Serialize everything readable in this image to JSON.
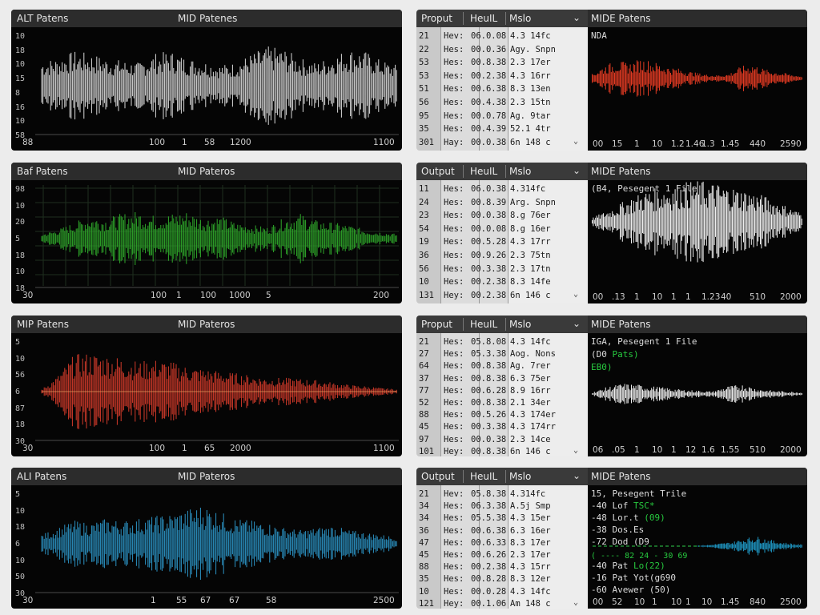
{
  "colors": {
    "white": "#d9d9d9",
    "green": "#2ea82a",
    "red": "#d23a2a",
    "blue": "#2b92c4",
    "log_white": "#eeeeee",
    "log_red": "#e03a22",
    "log_blue": "#1f9ac8",
    "log_green": "#2ed04b"
  },
  "wave_panels": [
    {
      "title_left": "ALT Patens",
      "title_right": "MID Patenes",
      "y_labels": [
        "10",
        "18",
        "10",
        "15",
        "8",
        "16",
        "10",
        "58"
      ],
      "x_labels": [
        "88",
        "100",
        "1",
        "58",
        "1200",
        "1100"
      ],
      "grid": false,
      "color": "white",
      "envelope": [
        0.55,
        0.6,
        0.75,
        0.7,
        0.6,
        0.55,
        0.5,
        0.7,
        0.75,
        0.6,
        0.55,
        0.45,
        0.5,
        0.7,
        0.85,
        0.8,
        0.6,
        0.5,
        0.65,
        0.8,
        0.75,
        0.55,
        0.45
      ]
    },
    {
      "title_left": "Baf Patens",
      "title_right": "MID Pateros",
      "y_labels": [
        "98",
        "10",
        "20",
        "5",
        "18",
        "10",
        "18"
      ],
      "x_labels": [
        "30",
        "100",
        "1",
        "100",
        "1000",
        "5",
        "200"
      ],
      "grid": true,
      "color": "green",
      "envelope": [
        0.1,
        0.2,
        0.35,
        0.5,
        0.45,
        0.55,
        0.6,
        0.5,
        0.55,
        0.6,
        0.45,
        0.5,
        0.35,
        0.3,
        0.25,
        0.45,
        0.55,
        0.4,
        0.35,
        0.3,
        0.2,
        0.15,
        0.1
      ]
    },
    {
      "title_left": "MIP Patens",
      "title_right": "MID Pateros",
      "y_labels": [
        "5",
        "10",
        "56",
        "6",
        "87",
        "18",
        "30"
      ],
      "x_labels": [
        "30",
        "100",
        "1",
        "65",
        "2000",
        "1100"
      ],
      "grid": false,
      "color": "red",
      "envelope": [
        0.05,
        0.35,
        0.8,
        0.85,
        0.8,
        0.75,
        0.65,
        0.7,
        0.65,
        0.55,
        0.5,
        0.45,
        0.4,
        0.35,
        0.3,
        0.3,
        0.28,
        0.25,
        0.2,
        0.15,
        0.12,
        0.08,
        0.05
      ]
    },
    {
      "title_left": "ALI Patens",
      "title_right": "MID Pateros",
      "y_labels": [
        "5",
        "10",
        "18",
        "6",
        "10",
        "50",
        "30"
      ],
      "x_labels": [
        "30",
        "1",
        "55",
        "67",
        "67",
        "58",
        "2500"
      ],
      "grid": false,
      "color": "blue",
      "envelope": [
        0.2,
        0.35,
        0.5,
        0.45,
        0.55,
        0.5,
        0.55,
        0.6,
        0.65,
        0.75,
        0.85,
        0.7,
        0.55,
        0.5,
        0.45,
        0.35,
        0.3,
        0.35,
        0.4,
        0.3,
        0.25,
        0.2,
        0.15
      ]
    }
  ],
  "tables": [
    {
      "headers": [
        "Proput",
        "HeuIL",
        "Mslo"
      ],
      "rows": [
        [
          "21",
          "Hev:",
          "06.0.08",
          "4.3 14fc"
        ],
        [
          "22",
          "Hes:",
          "00.0.36",
          "Agy. Snpn"
        ],
        [
          "53",
          "Hes:",
          "00.8.38",
          "2.3 17er"
        ],
        [
          "53",
          "Hes:",
          "00.2.38",
          "4.3 16rr"
        ],
        [
          "51",
          "Hes:",
          "00.6.38",
          "8.3 13en"
        ],
        [
          "56",
          "Hes:",
          "00.4.38",
          "2.3 15tn"
        ],
        [
          "95",
          "Hes:",
          "00.0.78",
          "Ag. 9tar"
        ],
        [
          "35",
          "Hes:",
          "00.4.39",
          "52.1 4tr"
        ],
        [
          "301",
          "Hay:",
          "00.0.38",
          "6n 148 c"
        ]
      ]
    },
    {
      "headers": [
        "Output",
        "HeuIL",
        "Mslo"
      ],
      "rows": [
        [
          "11",
          "Hes:",
          "06.0.38",
          "4.314fc"
        ],
        [
          "24",
          "Hes:",
          "00.8.39",
          "Arg. Snpn"
        ],
        [
          "23",
          "Hes:",
          "00.0.38",
          "8.g 76er"
        ],
        [
          "54",
          "Hes:",
          "00.0.08",
          "8.g 16er"
        ],
        [
          "19",
          "Hes:",
          "00.5.28",
          "4.3 17rr"
        ],
        [
          "36",
          "Hes:",
          "00.9.26",
          "2.3 75tn"
        ],
        [
          "56",
          "Hes:",
          "00.3.38",
          "2.3 17tn"
        ],
        [
          "10",
          "Hes:",
          "00.2.38",
          "8.3 14fe"
        ],
        [
          "131",
          "Hey:",
          "00.2.38",
          "6n 146 c"
        ]
      ]
    },
    {
      "headers": [
        "Proput",
        "HeuIL",
        "Mslo"
      ],
      "rows": [
        [
          "21",
          "Hes:",
          "05.8.08",
          "4.3 14fc"
        ],
        [
          "27",
          "Hes:",
          "05.3.38",
          "Aog. Nons"
        ],
        [
          "64",
          "Hes:",
          "00.8.38",
          "Ag. 7rer"
        ],
        [
          "37",
          "Hes:",
          "00.8.38",
          "6.3 75er"
        ],
        [
          "77",
          "Hes:",
          "00.6.28",
          "8.9 16rr"
        ],
        [
          "52",
          "Hes:",
          "00.8.38",
          "2.1 34er"
        ],
        [
          "88",
          "Hes:",
          "00.5.26",
          "4.3 174er"
        ],
        [
          "45",
          "Hes:",
          "00.3.38",
          "4.3 174rr"
        ],
        [
          "97",
          "Hes:",
          "00.0.38",
          "2.3 14ce"
        ],
        [
          "101",
          "Hey:",
          "00.8.38",
          "6n 146 c"
        ]
      ]
    },
    {
      "headers": [
        "Output",
        "HeuIL",
        "Mslo"
      ],
      "rows": [
        [
          "21",
          "Hev:",
          "05.8.38",
          "4.314fc"
        ],
        [
          "34",
          "Hes:",
          "06.3.38",
          "A.5j Smp"
        ],
        [
          "34",
          "Hes:",
          "05.5.38",
          "4.3 15er"
        ],
        [
          "36",
          "Hes:",
          "00.6.38",
          "6.3 16er"
        ],
        [
          "47",
          "Hes:",
          "00.6.33",
          "8.3 17er"
        ],
        [
          "45",
          "Hes:",
          "00.6.26",
          "2.3 17er"
        ],
        [
          "88",
          "Hes:",
          "00.2.38",
          "4.3 15rr"
        ],
        [
          "35",
          "Hes:",
          "00.8.28",
          "8.3 12er"
        ],
        [
          "10",
          "Hes:",
          "00.0.28",
          "4.3 14fc"
        ],
        [
          "121",
          "Hey:",
          "00.1.06",
          "Am 148 c"
        ]
      ]
    }
  ],
  "log_panels": [
    {
      "title": "MIDE Patens",
      "lines": [
        {
          "text": "NDA",
          "green": ""
        }
      ],
      "x_labels": [
        "00",
        "15",
        "1",
        "10",
        "1.2",
        "1.46",
        "1.3",
        "1.45",
        "440",
        "2590"
      ]
    },
    {
      "title": "MIDE Patens",
      "lines": [
        {
          "text": "(B4, Pesegent 1 File",
          "green": ""
        }
      ],
      "x_labels": [
        "00",
        ".13",
        "1",
        "10",
        "1",
        "1",
        "1.23",
        "40",
        "510",
        "2000"
      ]
    },
    {
      "title": "MIDE Patens",
      "lines": [
        {
          "text": "IGA, Pesegent 1 File",
          "green": ""
        },
        {
          "text": "(D0 ",
          "green": "Pats)"
        },
        {
          "text": "",
          "green": "EB0)"
        }
      ],
      "x_labels": [
        "06",
        ".05",
        "1",
        "10",
        "1",
        "12",
        "1.6",
        "1.55",
        "510",
        "2000"
      ]
    },
    {
      "title": "MIDE Patens",
      "lines": [
        {
          "text": "15, Pesegent Trile",
          "green": ""
        },
        {
          "text": "-40 Lof ",
          "green": "TSC*"
        },
        {
          "text": "-48 Lor.t ",
          "green": "(09)"
        },
        {
          "text": "-38 Dos.Es",
          "green": ""
        },
        {
          "text": "-72 Dod (D9",
          "green": ""
        },
        {
          "text": "",
          "green": "( ---- 82 24 - 30 69"
        },
        {
          "text": "-40 Pat ",
          "green": "Lo(22)"
        },
        {
          "text": "-16 Pat Yot(g690",
          "green": ""
        },
        {
          "text": "-60 Avewer (50)",
          "green": ""
        }
      ],
      "x_labels": [
        "00",
        "52",
        "10",
        "1",
        "10",
        "1",
        "10",
        "1.45",
        "840",
        "2500"
      ]
    }
  ]
}
